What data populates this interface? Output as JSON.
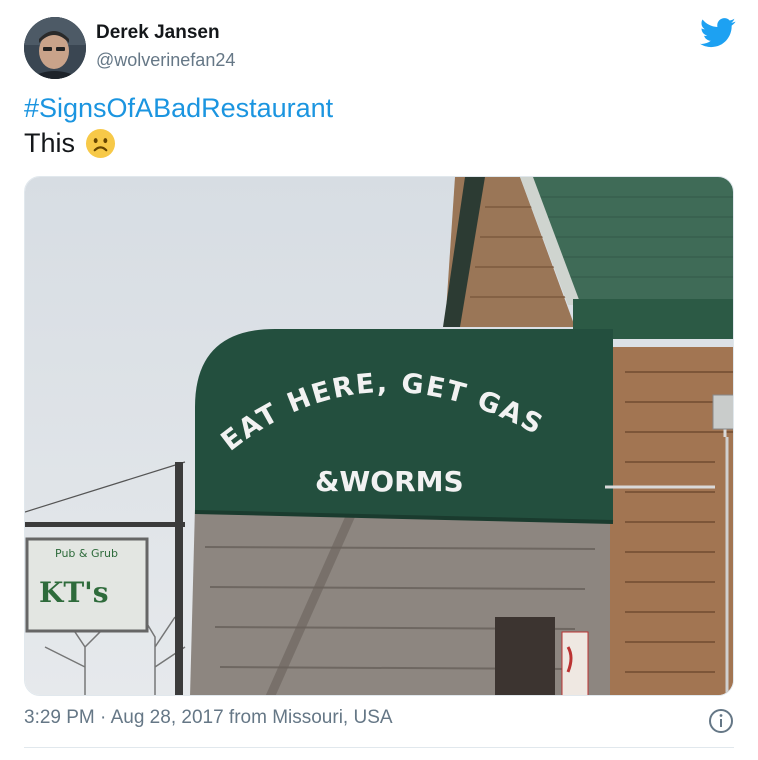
{
  "user": {
    "display_name": "Derek Jansen",
    "handle": "@wolverinefan24"
  },
  "tweet": {
    "hashtag": "#SignsOfABadRestaurant",
    "text": "This",
    "emoji": "frowning-face"
  },
  "photo": {
    "awning_line1": "EAT HERE, GET GAS",
    "awning_line2": "&WORMS",
    "pub_sign": "KT's",
    "pub_sign_small": "Pub & Grub"
  },
  "meta": {
    "timestamp": "3:29 PM · Aug 28, 2017 from Missouri, USA"
  },
  "colors": {
    "accent": "#1b95e0",
    "awning": "#234f3e"
  }
}
